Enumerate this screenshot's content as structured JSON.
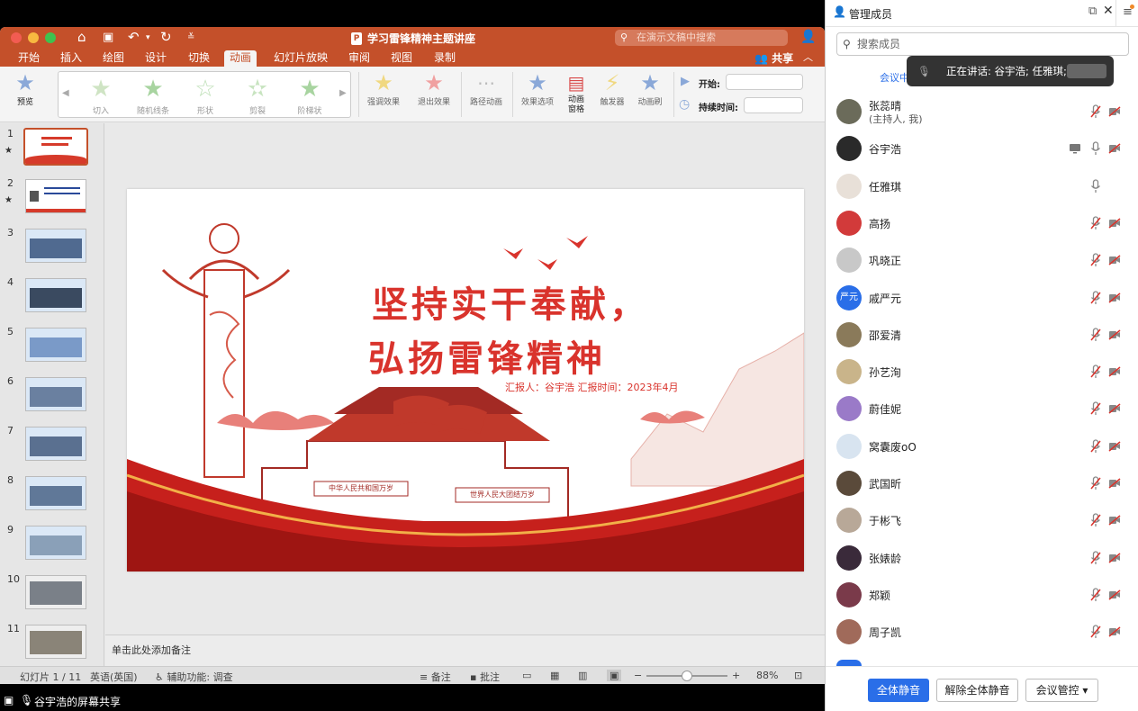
{
  "app": {
    "doc_title": "学习雷锋精神主题讲座",
    "search_placeholder": "在演示文稿中搜索",
    "share_label": "共享"
  },
  "menu_tabs": [
    {
      "label": "开始"
    },
    {
      "label": "插入"
    },
    {
      "label": "绘图"
    },
    {
      "label": "设计"
    },
    {
      "label": "切换"
    },
    {
      "label": "动画",
      "active": true
    },
    {
      "label": "幻灯片放映"
    },
    {
      "label": "审阅"
    },
    {
      "label": "视图"
    },
    {
      "label": "录制"
    }
  ],
  "ribbon": {
    "preview": "预览",
    "gallery": [
      "切入",
      "随机线条",
      "形状",
      "剪裂",
      "阶梯状"
    ],
    "emphasis": "强调效果",
    "exit": "退出效果",
    "path": "路径动画",
    "options": "效果选项",
    "pane_line1": "动画",
    "pane_line2": "窗格",
    "trigger": "触发器",
    "painter": "动画刷",
    "start_label": "开始:",
    "duration_label": "持续时间:"
  },
  "thumbnails": [
    {
      "num": "1",
      "star": true
    },
    {
      "num": "2",
      "star": true
    },
    {
      "num": "3"
    },
    {
      "num": "4"
    },
    {
      "num": "5"
    },
    {
      "num": "6"
    },
    {
      "num": "7"
    },
    {
      "num": "8"
    },
    {
      "num": "9"
    },
    {
      "num": "10"
    },
    {
      "num": "11"
    }
  ],
  "slide": {
    "title_line1": "坚持实干奉献，",
    "title_line2": "弘扬雷锋精神",
    "reporter": "汇报人：谷宇浩  汇报时间：2023年4月",
    "banner_left": "中华人民共和国万岁",
    "banner_right": "世界人民大团结万岁"
  },
  "notes_placeholder": "单击此处添加备注",
  "status": {
    "slide_pos": "幻灯片 1 / 11",
    "language": "英语(英国)",
    "accessibility": "辅助功能: 调查",
    "notes": "备注",
    "comments": "批注",
    "zoom": "88%",
    "zoom_fraction": 0.5
  },
  "share_bar": {
    "text": "谷宇浩的屏幕共享"
  },
  "panel": {
    "title": "管理成员",
    "search_placeholder": "搜索成员",
    "meeting_chip": "会议中",
    "speaking": "正在讲话: 谷宇浩; 任雅琪;",
    "members": [
      {
        "name": "张蕊晴",
        "sub": "(主持人, 我)",
        "mic": "muted",
        "cam": "off",
        "avatar_color": "#6b6b5a"
      },
      {
        "name": "谷宇浩",
        "mic": "on",
        "cam": "off",
        "screen": true,
        "avatar_color": "#2a2a2a"
      },
      {
        "name": "任雅琪",
        "mic": "on",
        "avatar_color": "#e8e0d8"
      },
      {
        "name": "高扬",
        "mic": "muted",
        "cam": "off",
        "avatar_color": "#d23a3a"
      },
      {
        "name": "巩晓正",
        "mic": "muted",
        "cam": "off",
        "avatar_color": "#c8c8c8"
      },
      {
        "name": "戚严元",
        "mic": "muted",
        "cam": "off",
        "avatar_color": "#2a6ee8",
        "avatar_text": "严元"
      },
      {
        "name": "邵爱清",
        "mic": "muted",
        "cam": "off",
        "avatar_color": "#8a7a5a"
      },
      {
        "name": "孙艺洵",
        "mic": "muted",
        "cam": "off",
        "avatar_color": "#c9b48a"
      },
      {
        "name": "蔚佳妮",
        "mic": "muted",
        "cam": "off",
        "avatar_color": "#9a7ac8"
      },
      {
        "name": "窝囊废oO",
        "mic": "muted",
        "cam": "off",
        "avatar_color": "#d8e4f0"
      },
      {
        "name": "武国昕",
        "mic": "muted",
        "cam": "off",
        "avatar_color": "#5a4a3a"
      },
      {
        "name": "于彬飞",
        "mic": "muted",
        "cam": "off",
        "avatar_color": "#b8a898"
      },
      {
        "name": "张婊龄",
        "mic": "muted",
        "cam": "off",
        "avatar_color": "#3a2a3a"
      },
      {
        "name": "郑颖",
        "mic": "muted",
        "cam": "off",
        "avatar_color": "#7a3a4a"
      },
      {
        "name": "周子凯",
        "mic": "muted",
        "cam": "off",
        "avatar_color": "#a06a5a"
      }
    ],
    "mute_all": "全体静音",
    "unmute_all": "解除全体静音",
    "meeting_control": "会议管控"
  }
}
